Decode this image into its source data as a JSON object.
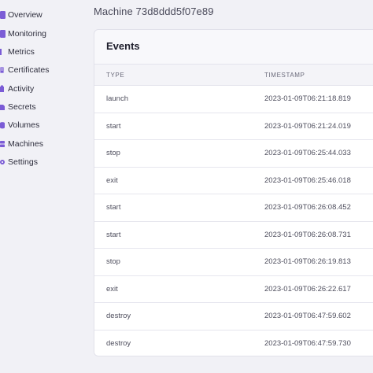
{
  "sidebar": {
    "items": [
      {
        "label": "Overview",
        "icon": "overview-icon"
      },
      {
        "label": "Monitoring",
        "icon": "monitoring-icon"
      },
      {
        "label": "Metrics",
        "icon": "metrics-icon"
      },
      {
        "label": "Certificates",
        "icon": "certificates-icon"
      },
      {
        "label": "Activity",
        "icon": "activity-icon"
      },
      {
        "label": "Secrets",
        "icon": "secrets-icon"
      },
      {
        "label": "Volumes",
        "icon": "volumes-icon"
      },
      {
        "label": "Machines",
        "icon": "machines-icon"
      },
      {
        "label": "Settings",
        "icon": "settings-icon"
      }
    ]
  },
  "header": {
    "machine_title": "Machine 73d8ddd5f07e89"
  },
  "events": {
    "title": "Events",
    "columns": {
      "type": "TYPE",
      "timestamp": "TIMESTAMP"
    },
    "rows": [
      {
        "type": "launch",
        "timestamp": "2023-01-09T06:21:18.819"
      },
      {
        "type": "start",
        "timestamp": "2023-01-09T06:21:24.019"
      },
      {
        "type": "stop",
        "timestamp": "2023-01-09T06:25:44.033"
      },
      {
        "type": "exit",
        "timestamp": "2023-01-09T06:25:46.018"
      },
      {
        "type": "start",
        "timestamp": "2023-01-09T06:26:08.452"
      },
      {
        "type": "start",
        "timestamp": "2023-01-09T06:26:08.731"
      },
      {
        "type": "stop",
        "timestamp": "2023-01-09T06:26:19.813"
      },
      {
        "type": "exit",
        "timestamp": "2023-01-09T06:26:22.617"
      },
      {
        "type": "destroy",
        "timestamp": "2023-01-09T06:47:59.602"
      },
      {
        "type": "destroy",
        "timestamp": "2023-01-09T06:47:59.730"
      }
    ]
  },
  "colors": {
    "accent": "#7b5cd6",
    "background": "#f1f1f6",
    "panel": "#ffffff"
  }
}
